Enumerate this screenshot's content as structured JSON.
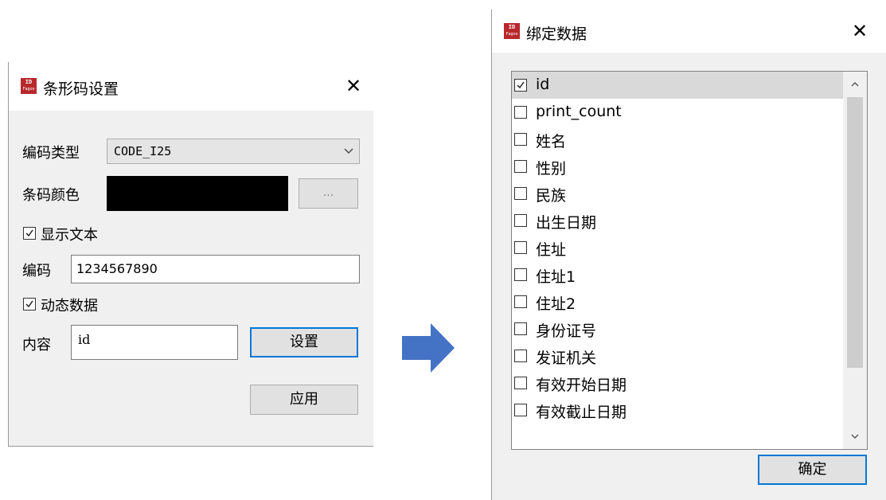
{
  "left_dialog": {
    "title": "条形码设置",
    "encoding_type_label": "编码类型",
    "encoding_type_value": "CODE_I25",
    "barcode_color_label": "条码颜色",
    "barcode_color": "#000000",
    "browse_button": "...",
    "show_text_label": "显示文本",
    "show_text_checked": true,
    "code_label": "编码",
    "code_value": "1234567890",
    "dynamic_data_label": "动态数据",
    "dynamic_data_checked": true,
    "content_label": "内容",
    "content_value": "id",
    "settings_button": "设置",
    "apply_button": "应用"
  },
  "right_dialog": {
    "title": "绑定数据",
    "items": [
      {
        "label": "id",
        "checked": true,
        "selected": true
      },
      {
        "label": "print_count",
        "checked": false
      },
      {
        "label": "姓名",
        "checked": false
      },
      {
        "label": "性别",
        "checked": false
      },
      {
        "label": "民族",
        "checked": false
      },
      {
        "label": "出生日期",
        "checked": false
      },
      {
        "label": "住址",
        "checked": false
      },
      {
        "label": "住址1",
        "checked": false
      },
      {
        "label": "住址2",
        "checked": false
      },
      {
        "label": "身份证号",
        "checked": false
      },
      {
        "label": "发证机关",
        "checked": false
      },
      {
        "label": "有效开始日期",
        "checked": false
      },
      {
        "label": "有效截止日期",
        "checked": false
      }
    ],
    "confirm_button": "确定"
  },
  "app_icon": {
    "line1": "ID",
    "line2": "Fagoo"
  },
  "colors": {
    "accent": "#0078d7",
    "arrow": "#4472c4",
    "icon": "#b8282c"
  }
}
